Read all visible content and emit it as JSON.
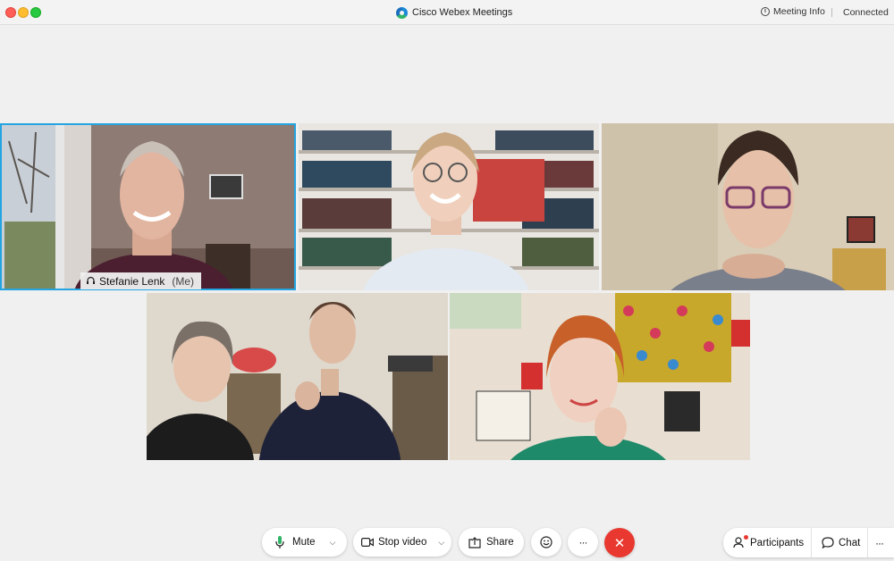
{
  "window": {
    "title": "Cisco Webex Meetings",
    "meeting_info_label": "Meeting Info",
    "status": "Connected"
  },
  "participants": [
    {
      "name": "Stefanie Lenk",
      "tag": "(Me)",
      "active": true
    },
    {
      "name": "",
      "active": false
    },
    {
      "name": "",
      "active": false
    },
    {
      "name": "",
      "active": false
    },
    {
      "name": "",
      "active": false
    }
  ],
  "toolbar": {
    "mute_label": "Mute",
    "stop_video_label": "Stop video",
    "share_label": "Share",
    "participants_label": "Participants",
    "chat_label": "Chat",
    "more_glyph": "···",
    "end_glyph": "✕"
  },
  "colors": {
    "accent": "#24a4e0",
    "end_call": "#e8382f",
    "mic_active": "#2fb567"
  },
  "icons": [
    "webex-logo",
    "info-icon",
    "headset-icon",
    "microphone-icon",
    "video-camera-icon",
    "share-icon",
    "emoji-reaction-icon",
    "more-options-icon",
    "end-call-icon",
    "participants-icon",
    "chat-icon"
  ]
}
